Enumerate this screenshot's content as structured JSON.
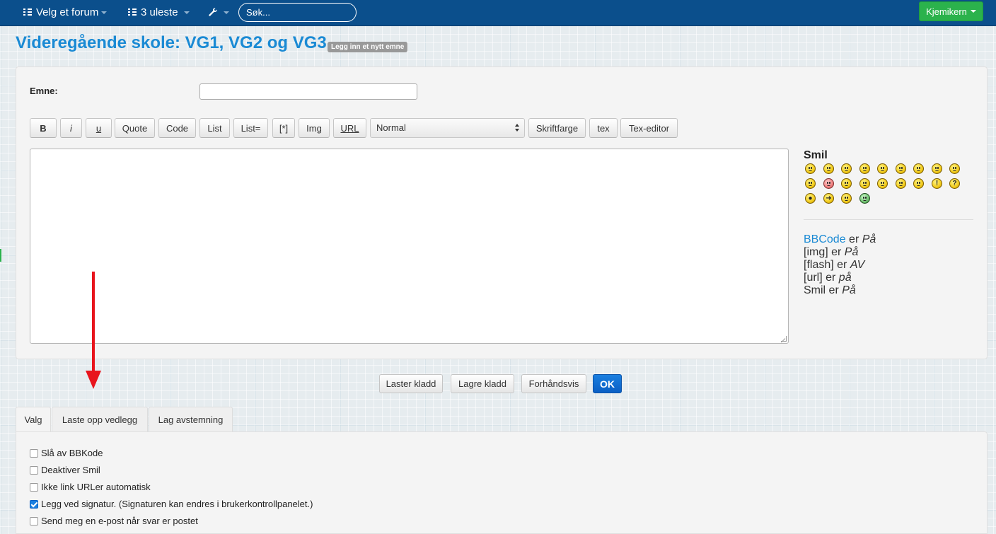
{
  "navbar": {
    "forum_label": "Velg et forum",
    "unread_label": "3 uleste",
    "search_placeholder": "Søk...",
    "user_label": "Kjemikern"
  },
  "page": {
    "title": "Videregående skole: VG1, VG2 og VG3",
    "badge": "Legg inn et nytt emne"
  },
  "form": {
    "subject_label": "Emne:",
    "subject_value": ""
  },
  "toolbar": {
    "bold": "B",
    "italic": "i",
    "underline": "u",
    "quote": "Quote",
    "code": "Code",
    "list": "List",
    "list_numbered": "List=",
    "list_item": "[*]",
    "img": "Img",
    "url": "URL",
    "font_size_selected": "Normal",
    "font_color": "Skriftfarge",
    "tex": "tex",
    "tex_editor": "Tex-editor"
  },
  "sidebar": {
    "smilies_title": "Smil",
    "bbcode_link": "BBCode",
    "bbcode_status_prefix": " er ",
    "bbcode_status": "På",
    "img_label": "[img] er ",
    "img_status": "På",
    "flash_label": "[flash] er ",
    "flash_status": "AV",
    "url_label": "[url] er ",
    "url_status": "på",
    "smil_label": "Smil er ",
    "smil_status": "På"
  },
  "smilies": [
    "very-happy-icon",
    "smile-icon",
    "sad-icon",
    "surprised-icon",
    "shocked-icon",
    "confused-icon",
    "cool-icon",
    "laughing-icon",
    "mad-icon",
    "razz-icon",
    "embarrassed-icon",
    "crying-icon",
    "evil-icon",
    "twisted-evil-icon",
    "rolling-eyes-icon",
    "wink-icon",
    "exclamation-icon",
    "question-icon",
    "idea-icon",
    "arrow-icon",
    "neutral-icon",
    "mr-green-icon"
  ],
  "actions": {
    "load_draft": "Laster kladd",
    "save_draft": "Lagre kladd",
    "preview": "Forhåndsvis",
    "submit": "OK"
  },
  "tabs": [
    {
      "label": "Valg"
    },
    {
      "label": "Laste opp vedlegg"
    },
    {
      "label": "Lag avstemning"
    }
  ],
  "options": [
    {
      "label": "Slå av BBKode",
      "checked": false
    },
    {
      "label": "Deaktiver Smil",
      "checked": false
    },
    {
      "label": "Ikke link URLer automatisk",
      "checked": false
    },
    {
      "label": "Legg ved signatur. (Signaturen kan endres i brukerkontrollpanelet.)",
      "checked": true
    },
    {
      "label": "Send meg en e-post når svar er postet",
      "checked": false
    }
  ],
  "colors": {
    "navbar": "#0b4f8c",
    "title": "#1a8ad4",
    "user_button": "#2bb24c",
    "ok_button": "#0a5fc4",
    "arrow": "#e8141c"
  }
}
